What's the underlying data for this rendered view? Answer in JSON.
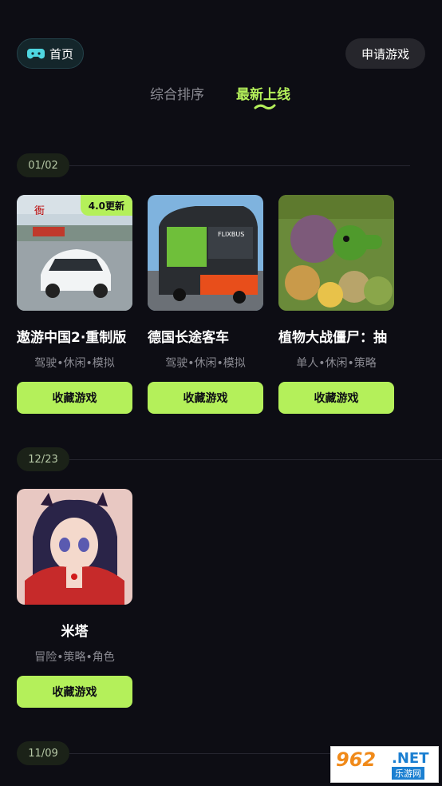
{
  "header": {
    "home_label": "首页",
    "apply_label": "申请游戏"
  },
  "tabs": [
    {
      "label": "综合排序",
      "active": false
    },
    {
      "label": "最新上线",
      "active": true
    }
  ],
  "sections": [
    {
      "date": "01/02",
      "games": [
        {
          "title": "遨游中国2·重制版",
          "tags": "驾驶•休闲•模拟",
          "badge": "4.0更新",
          "button": "收藏游戏",
          "icon": "driving-car-icon"
        },
        {
          "title": "德国长途客车",
          "tags": "驾驶•休闲•模拟",
          "button": "收藏游戏",
          "icon": "bus-icon"
        },
        {
          "title": "植物大战僵尸：抽",
          "tags": "单人•休闲•策略",
          "button": "收藏游戏",
          "icon": "plant-zombie-icon"
        }
      ]
    },
    {
      "date": "12/23",
      "games": [
        {
          "title": "米塔",
          "tags": "冒险•策略•角色",
          "button": "收藏游戏",
          "icon": "anime-girl-icon"
        }
      ]
    },
    {
      "date": "11/09",
      "games": []
    }
  ],
  "colors": {
    "background": "#0d0d14",
    "accent": "#b4f05a",
    "muted_text": "#8a8a92"
  },
  "watermark": {
    "number": "962",
    "domain": ".NET",
    "sub": "乐游网"
  }
}
